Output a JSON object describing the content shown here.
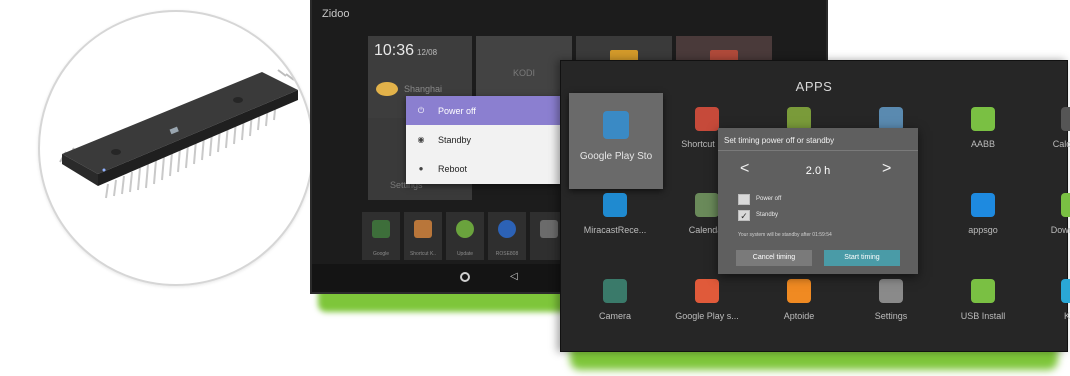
{
  "launcher": {
    "brand": "Zidoo",
    "time": "10:36",
    "date": "12/08",
    "weather": "Shanghai",
    "kodi_label": "KODI",
    "settings_label": "Settings",
    "dock": [
      {
        "label": "Google",
        "color": "#3d6e3a"
      },
      {
        "label": "Shortcut K..",
        "color": "#b9763a"
      },
      {
        "label": "Update",
        "color": "#6aa33d"
      },
      {
        "label": "ROSE808",
        "color": "#2c62b6"
      },
      {
        "label": "",
        "color": "#6b6b6b"
      }
    ],
    "power_menu": [
      {
        "label": "Power off",
        "icon": "power-icon",
        "glyph": "⏻",
        "selected": true
      },
      {
        "label": "Standby",
        "icon": "standby-icon",
        "glyph": "◉",
        "selected": false
      },
      {
        "label": "Reboot",
        "icon": "reboot-icon",
        "glyph": "●",
        "selected": false
      }
    ]
  },
  "apps": {
    "title": "APPS",
    "items": [
      {
        "name": "Google Play Sto",
        "icon": "play-store-icon",
        "color": "#3a8ac5",
        "focused": true
      },
      {
        "name": "Shortcut Key",
        "icon": "shortcut-icon",
        "color": "#c64a3a"
      },
      {
        "name": "",
        "icon": "app-icon",
        "color": "#7a9b3a"
      },
      {
        "name": "",
        "icon": "app-icon",
        "color": "#5a8ab0"
      },
      {
        "name": "AABB",
        "icon": "android-icon",
        "color": "#7ac043"
      },
      {
        "name": "Calculator",
        "icon": "calculator-icon",
        "color": "#555555"
      },
      {
        "name": "MiracastRece...",
        "icon": "miracast-icon",
        "color": "#1f8ad0"
      },
      {
        "name": "Calendar",
        "icon": "calendar-icon",
        "color": "#6a8a5a"
      },
      {
        "name": "appsgo",
        "icon": "appsgo-icon",
        "color": "#1e8ae0"
      },
      {
        "name": "Downloads",
        "icon": "download-icon",
        "color": "#7ac043"
      },
      {
        "name": "Camera",
        "icon": "camera-icon",
        "color": "#3a7a6a"
      },
      {
        "name": "Google Play s...",
        "icon": "play-games-icon",
        "color": "#e05a3a"
      },
      {
        "name": "Aptoide",
        "icon": "aptoide-icon",
        "color": "#f08a22"
      },
      {
        "name": "Settings",
        "icon": "gear-icon",
        "color": "#8a8a8a"
      },
      {
        "name": "USB Install",
        "icon": "usb-install-icon",
        "color": "#7ac043"
      },
      {
        "name": "Kodi",
        "icon": "kodi-icon",
        "color": "#2aa7d6"
      }
    ]
  },
  "timing_dialog": {
    "title": "Set timing power off or standby",
    "value": "2.0 h",
    "options": [
      {
        "label": "Power off",
        "checked": false
      },
      {
        "label": "Standby",
        "checked": true
      }
    ],
    "note": "Your system will be standby after  01:59:54",
    "cancel_label": "Cancel timing",
    "start_label": "Start timing"
  }
}
